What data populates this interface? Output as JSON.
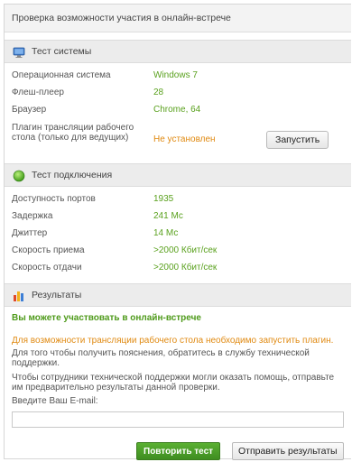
{
  "title": "Проверка возможности участия в онлайн-встрече",
  "system_test": {
    "header": "Тест системы",
    "rows": [
      {
        "label": "Операционная система",
        "value": "Windows 7"
      },
      {
        "label": "Флеш-плеер",
        "value": "28"
      },
      {
        "label": "Браузер",
        "value": "Chrome, 64"
      },
      {
        "label": "Плагин трансляции рабочего стола (только для ведущих)",
        "value": "Не установлен"
      }
    ],
    "run_button": "Запустить"
  },
  "connection_test": {
    "header": "Тест подключения",
    "rows": [
      {
        "label": "Доступность портов",
        "value": "1935"
      },
      {
        "label": "Задержка",
        "value": "241 Мс"
      },
      {
        "label": "Джиттер",
        "value": "14 Мс"
      },
      {
        "label": "Скорость приема",
        "value": ">2000  Кбит/сек"
      },
      {
        "label": "Скорость отдачи",
        "value": ">2000  Кбит/сек"
      }
    ]
  },
  "results": {
    "header": "Результаты",
    "ok": "Вы можете участвовать в онлайн-встрече",
    "warning": "Для возможности трансляции рабочего стола необходимо запустить плагин.",
    "support_text": "Для того чтобы получить пояснения, обратитесь в службу технической поддержки.",
    "send_text": "Чтобы сотрудники технической поддержки могли оказать помощь, отправьте им предварительно результаты данной проверки.",
    "email_label": "Введите Ваш E-mail:",
    "email_value": "",
    "repeat_button": "Повторить тест",
    "send_button": "Отправить результаты"
  },
  "colors": {
    "ok": "#5aa11e",
    "warning": "#e08a12"
  }
}
